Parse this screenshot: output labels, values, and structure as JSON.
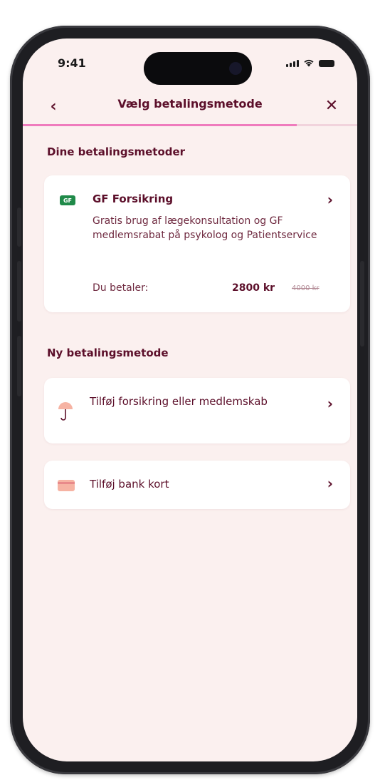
{
  "status_bar": {
    "time": "9:41"
  },
  "nav": {
    "back_icon": "chevron-left-icon",
    "title": "Vælg betalingsmetode",
    "close_icon": "close-icon",
    "progress": 0.82
  },
  "saved_methods": {
    "section_title": "Dine betalingsmetoder",
    "items": [
      {
        "badge": "GF",
        "name": "GF Forsikring",
        "description": "Gratis brug af lægekonsultation og GF medlemsrabat på psykolog og Patientservice",
        "pay_label": "Du betaler:",
        "price": "2800 kr",
        "old_price": "4000 kr"
      }
    ]
  },
  "new_methods": {
    "section_title": "Ny betalingsmetode",
    "items": [
      {
        "label": "Tilføj forsikring eller medlemskab",
        "icon": "umbrella-icon"
      },
      {
        "label": "Tilføj bank kort",
        "icon": "credit-card-icon"
      }
    ]
  },
  "colors": {
    "primary": "#5c0f2a",
    "accent": "#ef7bbd",
    "background": "#fbf0ef",
    "gf_green": "#1f8a49"
  }
}
